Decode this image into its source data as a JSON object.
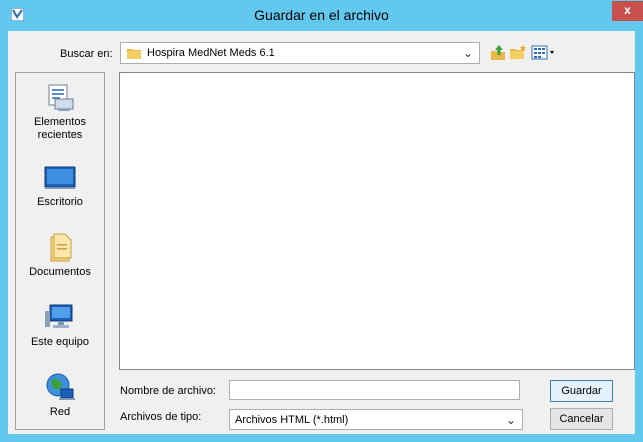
{
  "window": {
    "title": "Guardar en el archivo",
    "close_label": "x",
    "accent_color": "#63c8ee"
  },
  "lookin": {
    "label": "Buscar en:",
    "value": "Hospira MedNet Meds 6.1"
  },
  "toolbar": {
    "icons": [
      "up-folder-icon",
      "new-folder-icon",
      "view-menu-icon"
    ]
  },
  "places": [
    {
      "label_1": "Elementos",
      "label_2": "recientes",
      "icon": "recent-items-icon"
    },
    {
      "label_1": "Escritorio",
      "icon": "desktop-icon"
    },
    {
      "label_1": "Documentos",
      "icon": "documents-icon"
    },
    {
      "label_1": "Este equipo",
      "icon": "computer-icon"
    },
    {
      "label_1": "Red",
      "icon": "network-icon"
    }
  ],
  "filename": {
    "label": "Nombre de archivo:",
    "value": ""
  },
  "filetype": {
    "label": "Archivos de tipo:",
    "value": "Archivos HTML (*.html)"
  },
  "buttons": {
    "save": "Guardar",
    "cancel": "Cancelar"
  }
}
